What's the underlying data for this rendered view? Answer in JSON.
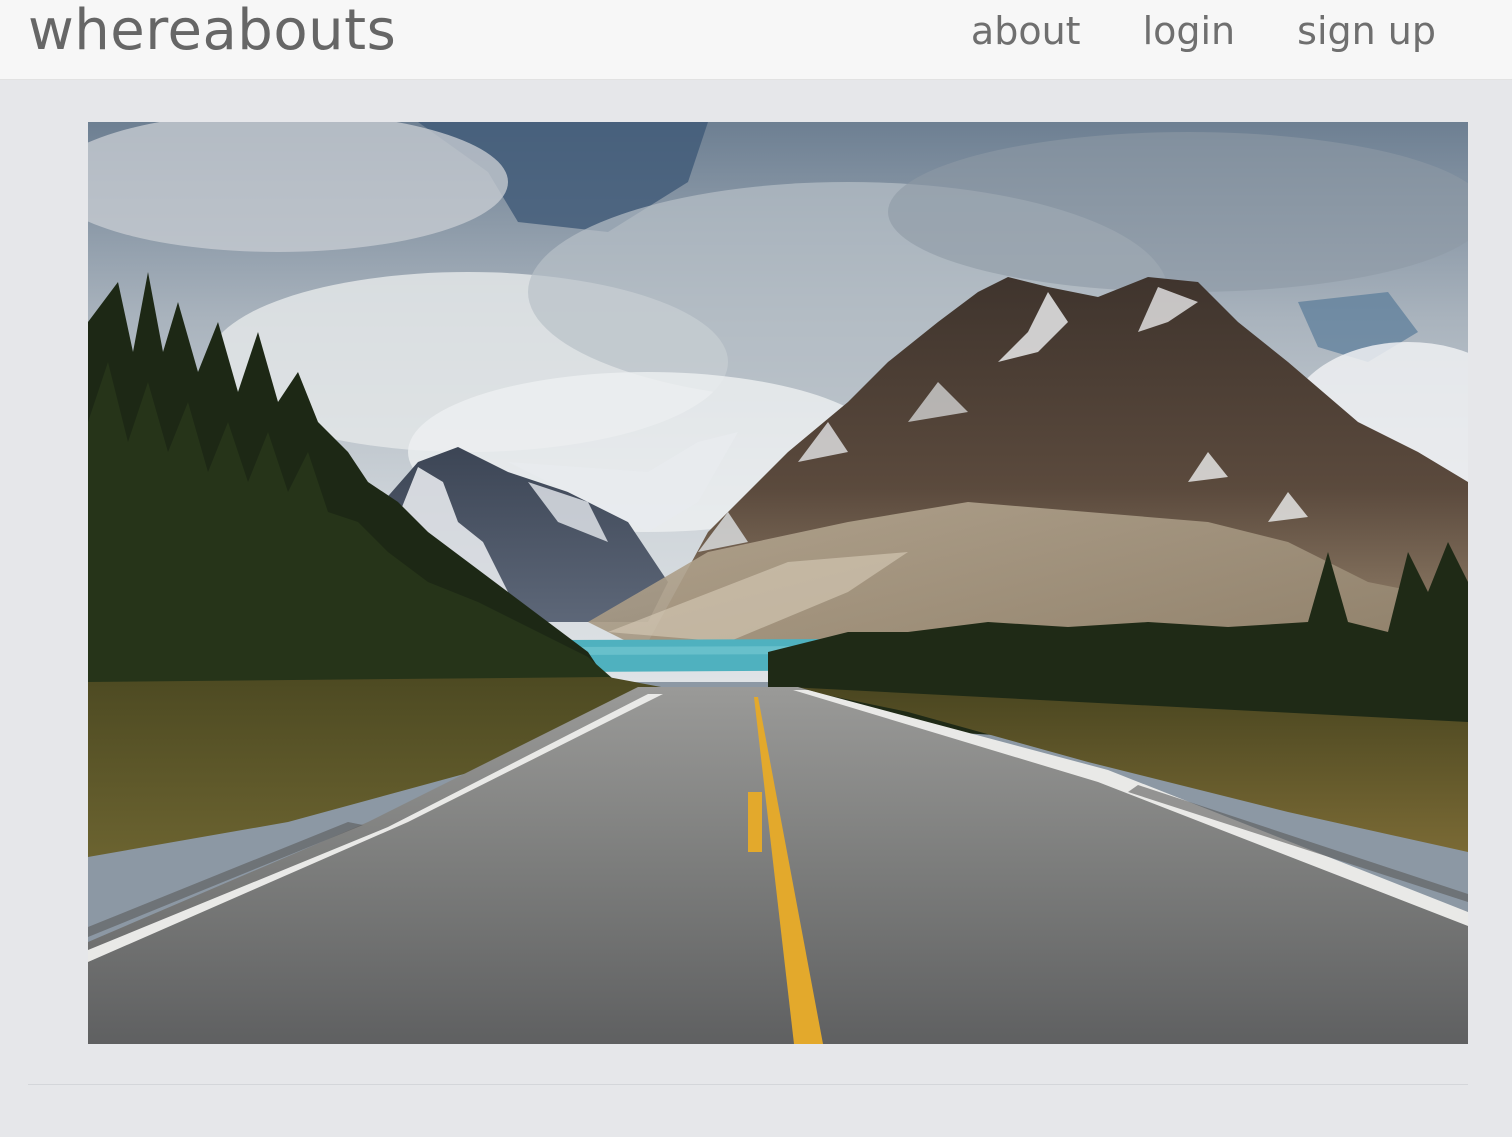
{
  "navbar": {
    "brand": "whereabouts",
    "links": [
      {
        "label": "about"
      },
      {
        "label": "login"
      },
      {
        "label": "sign up"
      }
    ]
  },
  "hero": {
    "image_subject": "mountain-road-landscape-photo"
  },
  "colors": {
    "page_background": "#e6e7ea",
    "navbar_background": "#f7f7f7",
    "text": "#6f6f6f"
  }
}
